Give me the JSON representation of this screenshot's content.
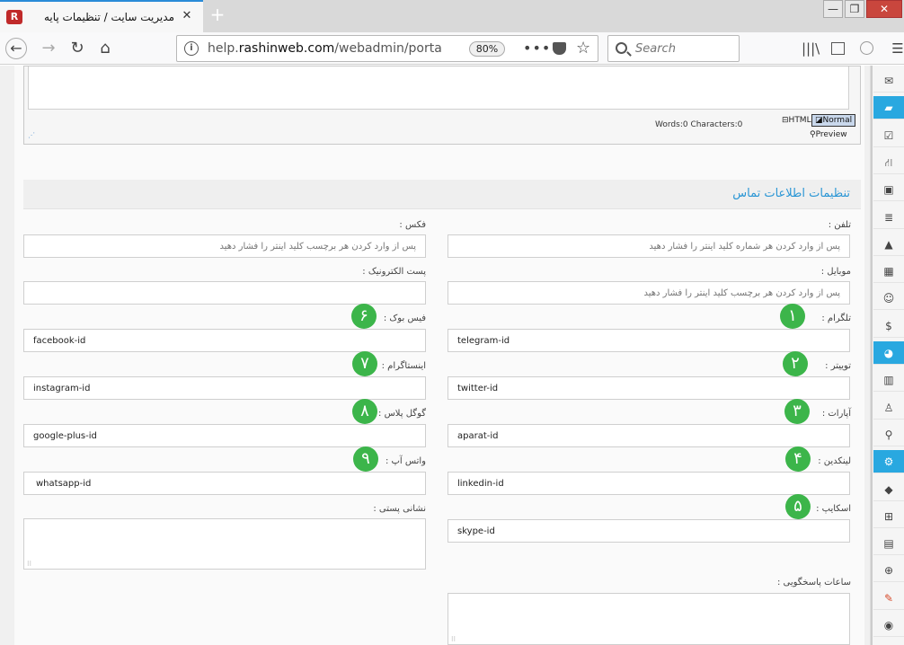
{
  "browser": {
    "tab_title": "مدیریت سایت / تنظیمات پایه",
    "tab_close": "✕",
    "new_tab": "+",
    "favicon": "R",
    "url_prefix": "help.",
    "url_domain": "rashinweb.com",
    "url_path": "/webadmin/portal_con",
    "zoom": "80%",
    "search_placeholder": "Search",
    "window_controls": {
      "minimize": "—",
      "maximize": "❐",
      "close": "✕"
    }
  },
  "editor": {
    "word_count": "Words:0 Characters:0",
    "mode_html": "HTML",
    "mode_normal": "Normal",
    "mode_preview": "Preview"
  },
  "section": {
    "title": "تنظیمات اطلاعات تماس"
  },
  "fields": {
    "phone": {
      "label": "تلفن :",
      "placeholder": "پس از وارد کردن هر شماره کلید اینتر را فشار دهید"
    },
    "fax": {
      "label": "فکس :",
      "placeholder": "پس از وارد کردن هر برچسب کلید اینتر را فشار دهید"
    },
    "mobile": {
      "label": "موبایل :",
      "placeholder": "پس از وارد کردن هر برچسب کلید اینتر را فشار دهید"
    },
    "email": {
      "label": "پست الکترونیک :",
      "value": ""
    },
    "telegram": {
      "label": "تلگرام :",
      "value": "telegram-id",
      "badge": "۱"
    },
    "facebook": {
      "label": "فیس بوک :",
      "value": "facebook-id",
      "badge": "۶"
    },
    "twitter": {
      "label": "توییتر :",
      "value": "twitter-id",
      "badge": "۲"
    },
    "instagram": {
      "label": "اینستاگرام :",
      "value": "instagram-id",
      "badge": "۷"
    },
    "aparat": {
      "label": "آپارات :",
      "value": "aparat-id",
      "badge": "۳"
    },
    "googleplus": {
      "label": "گوگل پلاس :",
      "value": "google-plus-id",
      "badge": "۸"
    },
    "linkedin": {
      "label": "لینکدین :",
      "value": "linkedin-id",
      "badge": "۴"
    },
    "whatsapp": {
      "label": "واتس آپ :",
      "value": "whatsapp-id",
      "badge": "۹"
    },
    "skype": {
      "label": "اسکایپ :",
      "value": "skype-id",
      "badge": "۵"
    },
    "address": {
      "label": "نشانی پستی :"
    },
    "hours": {
      "label": "ساعات پاسخگویی :"
    }
  },
  "right_panel": {
    "icons": [
      "mail-icon",
      "folder-open-icon",
      "check-square-icon",
      "sitemap-icon",
      "lock-icon",
      "list-icon",
      "road-icon",
      "calendar-icon",
      "users-icon",
      "dollar-icon",
      "pie-chart-icon",
      "bar-chart-icon",
      "user-icon",
      "search-icon",
      "gear-icon",
      "tags-icon",
      "windows-icon",
      "file-icon",
      "zoom-in-icon",
      "wrench-icon",
      "globe-icon"
    ],
    "active_color": "#29a8e0"
  },
  "colors": {
    "badge": "#3cb54a",
    "section_title": "#2a96d5"
  }
}
